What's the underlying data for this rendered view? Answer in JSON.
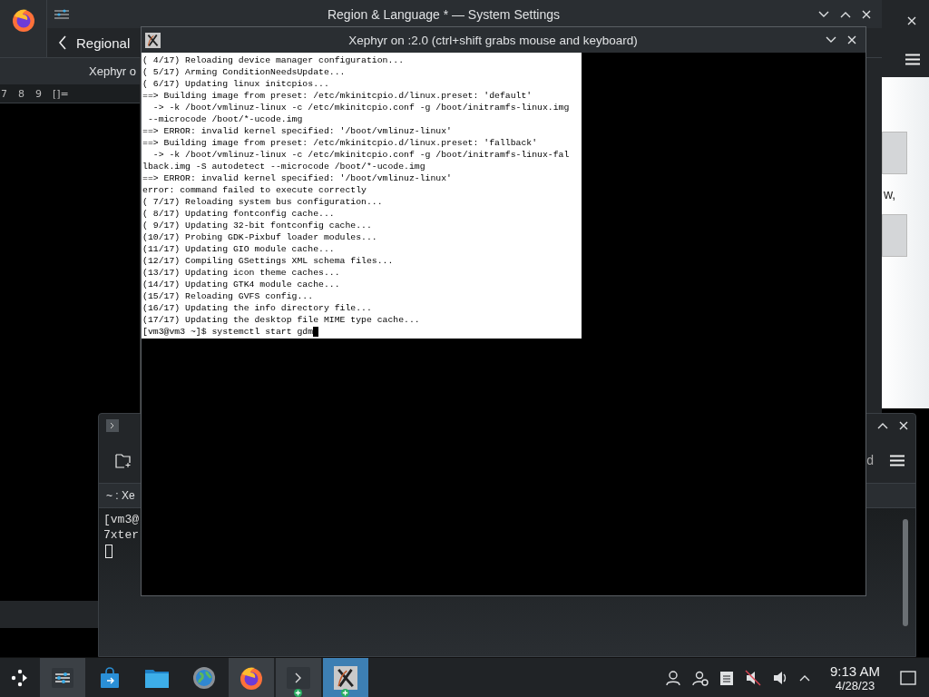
{
  "settings_window": {
    "title": "Region & Language * — System Settings",
    "page_title": "Regional"
  },
  "left_window": {
    "tab_label": "Xephyr o",
    "keys": [
      "7",
      "8",
      "9",
      "[]="
    ]
  },
  "right_window": {
    "text": "w,"
  },
  "konsole_window": {
    "toolbar_text": "d",
    "tab_label": "~ : Xe",
    "lines": [
      "[vm3@",
      "7xter"
    ]
  },
  "xephyr_window": {
    "title": "Xephyr on :2.0 (ctrl+shift grabs mouse and keyboard)",
    "lines": [
      "( 4/17) Reloading device manager configuration...",
      "( 5/17) Arming ConditionNeedsUpdate...",
      "( 6/17) Updating linux initcpios...",
      "==> Building image from preset: /etc/mkinitcpio.d/linux.preset: 'default'",
      "  -> -k /boot/vmlinuz-linux -c /etc/mkinitcpio.conf -g /boot/initramfs-linux.img",
      " --microcode /boot/*-ucode.img",
      "==> ERROR: invalid kernel specified: '/boot/vmlinuz-linux'",
      "==> Building image from preset: /etc/mkinitcpio.d/linux.preset: 'fallback'",
      "  -> -k /boot/vmlinuz-linux -c /etc/mkinitcpio.conf -g /boot/initramfs-linux-fal",
      "lback.img -S autodetect --microcode /boot/*-ucode.img",
      "==> ERROR: invalid kernel specified: '/boot/vmlinuz-linux'",
      "error: command failed to execute correctly",
      "( 7/17) Reloading system bus configuration...",
      "( 8/17) Updating fontconfig cache...",
      "( 9/17) Updating 32-bit fontconfig cache...",
      "(10/17) Probing GDK-Pixbuf loader modules...",
      "(11/17) Updating GIO module cache...",
      "(12/17) Compiling GSettings XML schema files...",
      "(13/17) Updating icon theme caches...",
      "(14/17) Updating GTK4 module cache...",
      "(15/17) Reloading GVFS config...",
      "(16/17) Updating the info directory file...",
      "(17/17) Updating the desktop file MIME type cache..."
    ],
    "prompt": "[vm3@vm3 ~]$ systemctl start gdm"
  },
  "taskbar": {
    "apps": [
      {
        "kind": "settings",
        "running": true,
        "selected": false,
        "badge": false
      },
      {
        "kind": "store",
        "running": false,
        "selected": false,
        "badge": false
      },
      {
        "kind": "files",
        "running": false,
        "selected": false,
        "badge": false
      },
      {
        "kind": "globe",
        "running": false,
        "selected": false,
        "badge": false
      },
      {
        "kind": "firefox",
        "running": true,
        "selected": false,
        "badge": false
      },
      {
        "kind": "terminal",
        "running": true,
        "selected": false,
        "badge": true
      },
      {
        "kind": "xephyr",
        "running": true,
        "selected": true,
        "badge": true
      }
    ],
    "time": "9:13 AM",
    "date": "4/28/23"
  }
}
